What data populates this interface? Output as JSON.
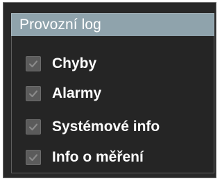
{
  "panel": {
    "title": "Provozní log",
    "items": [
      {
        "label": "Chyby",
        "checked": true
      },
      {
        "label": "Alarmy",
        "checked": true
      },
      {
        "label": "Systémové info",
        "checked": true
      },
      {
        "label": "Info o měření",
        "checked": true
      }
    ]
  },
  "colors": {
    "header_bg": "#8fa3ac",
    "panel_bg": "#282828",
    "checkbox_bg": "#5b5b5b",
    "checkmark": "#8a8a8a",
    "text": "#ffffff"
  }
}
